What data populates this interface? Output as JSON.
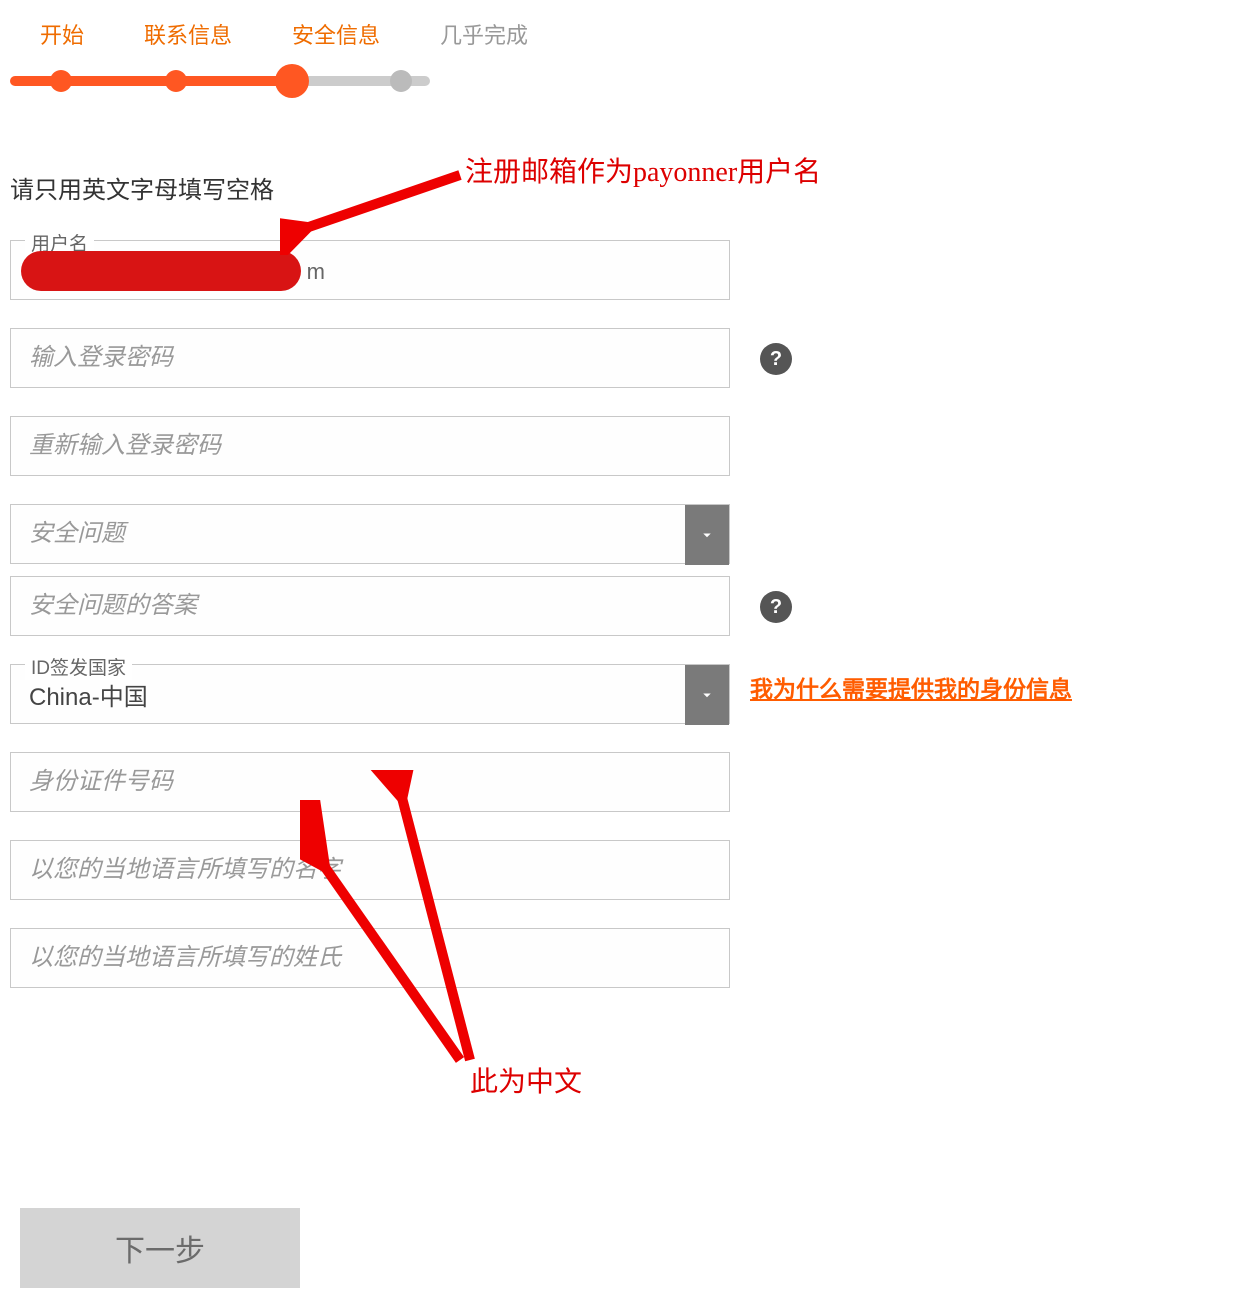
{
  "steps": {
    "s1": "开始",
    "s2": "联系信息",
    "s3": "安全信息",
    "s4": "几乎完成"
  },
  "instruction": "请只用英文字母填写空格",
  "fields": {
    "username_label": "用户名",
    "password_placeholder": "输入登录密码",
    "repassword_placeholder": "重新输入登录密码",
    "secq_placeholder": "安全问题",
    "secans_placeholder": "安全问题的答案",
    "idcountry_label": "ID签发国家",
    "idcountry_value": "China-中国",
    "idnum_placeholder": "身份证件号码",
    "firstname_placeholder": "以您的当地语言所填写的名字",
    "lastname_placeholder": "以您的当地语言所填写的姓氏"
  },
  "link_idinfo": "我为什么需要提供我的身份信息",
  "next_button": "下一步",
  "annotations": {
    "a1": "注册邮箱作为payonner用户名",
    "a2": "此为中文"
  },
  "icons": {
    "help": "?",
    "chevron": "chevron-down-icon"
  }
}
